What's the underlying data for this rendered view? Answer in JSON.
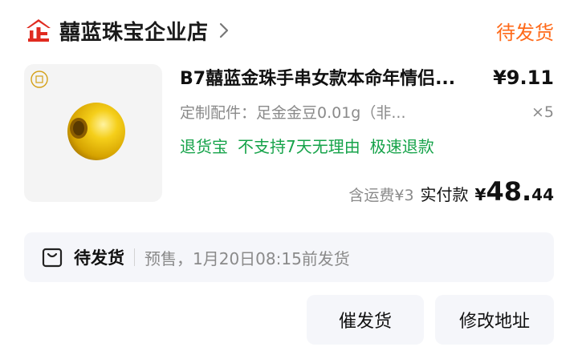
{
  "colors": {
    "accent_orange": "#ff6a1a",
    "green": "#16a34a",
    "store_red": "#e02b20",
    "panel_bg": "#f5f6fa"
  },
  "header": {
    "store_icon": "shop-enterprise-icon",
    "store_name": "囍蓝珠宝企业店",
    "status": "待发货"
  },
  "item": {
    "title": "B7囍蓝金珠手串女款本命年情侣...",
    "price": "¥9.11",
    "spec": "定制配件：足金金豆0.01g（非...",
    "qty": "×5",
    "tags": [
      "退货宝",
      "不支持7天无理由",
      "极速退款"
    ],
    "thumb_icon": "gold-bead-image"
  },
  "totals": {
    "shipping": "含运费¥3",
    "paid_label": "实付款",
    "paid_currency": "¥",
    "paid_int": "48.",
    "paid_dec": "44"
  },
  "notice": {
    "icon": "bag-icon",
    "status": "待发货",
    "text": "预售，1月20日08:15前发货"
  },
  "buttons": {
    "urge": "催发货",
    "change_address": "修改地址"
  }
}
